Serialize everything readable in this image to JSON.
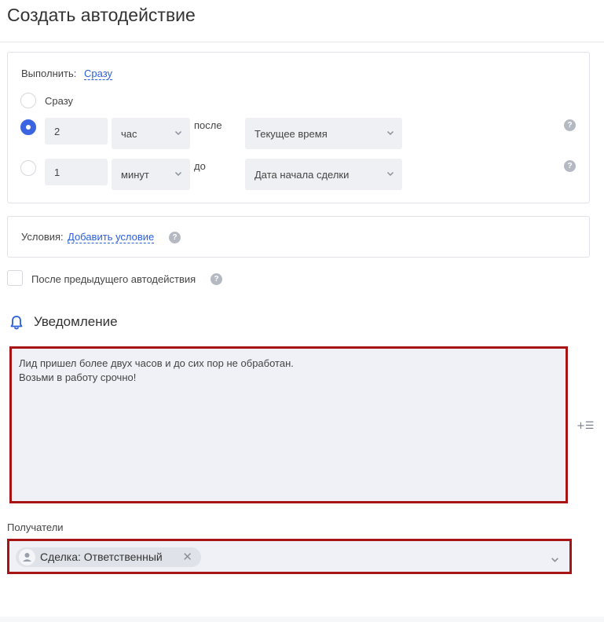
{
  "page": {
    "title": "Создать автодействие"
  },
  "execute": {
    "label": "Выполнить:",
    "mode_link": "Сразу",
    "option_immediately": "Сразу",
    "row1": {
      "amount": "2",
      "unit": "час",
      "relation": "после",
      "anchor": "Текущее время",
      "selected": true
    },
    "row2": {
      "amount": "1",
      "unit": "минут",
      "relation": "до",
      "anchor": "Дата начала сделки",
      "selected": false
    },
    "help_glyph": "?"
  },
  "conditions": {
    "label": "Условия:",
    "add_link": "Добавить условие",
    "help_glyph": "?"
  },
  "after_previous": {
    "label": "После предыдущего автодействия",
    "checked": false,
    "help_glyph": "?"
  },
  "notification": {
    "title": "Уведомление",
    "icon": "bell-icon",
    "message_lines": [
      "Лид пришел более двух часов и до сих пор не обработан.",
      "Возьми в работу срочно!"
    ],
    "insert_icon_glyph": "+☰"
  },
  "recipients": {
    "label": "Получатели",
    "tags": [
      {
        "text": "Сделка: Ответственный",
        "remove_glyph": "✕"
      }
    ]
  },
  "colors": {
    "accent": "#3b64e0",
    "link": "#2b5fd9",
    "highlight_border": "#a81414",
    "field_bg": "#eef0f4"
  }
}
